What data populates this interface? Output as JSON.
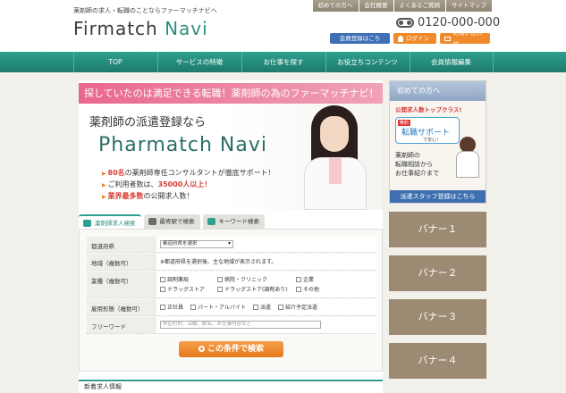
{
  "header": {
    "tagline": "薬剤師の求人・転職のことならファーマッチナビへ",
    "logo_main": "Firmatch ",
    "logo_accent": "Navi",
    "top_links": [
      "初めての方へ",
      "会社概要",
      "よくあるご質問",
      "サイトマップ"
    ],
    "tel": "0120-000-000",
    "buttons": {
      "register": "会員登録はこちら！",
      "login": "ログイン",
      "contact": "お問い合わせ"
    }
  },
  "nav": [
    "TOP",
    "サービスの特徴",
    "お仕事を探す",
    "お役立ちコンテンツ",
    "会員情報編集"
  ],
  "hero": {
    "headline": "探していたのは満足できる転職！薬剤師の為のファーマッチナビ！",
    "sub": "薬剤師の派遣登録なら",
    "brand": "Pharmatch Navi",
    "points": [
      {
        "hl": "80名",
        "text": "の薬剤師専任コンサルタントが徹底サポート！"
      },
      {
        "pre": "ご利用者数は、",
        "hl": "35000人以上！",
        "text": ""
      },
      {
        "hl": "業界最多数",
        "text": "の公開求人数！"
      }
    ]
  },
  "tabs": [
    "薬剤師求人検索",
    "最寄駅で検索",
    "キーワード検索"
  ],
  "search": {
    "pref_label": "都道府県",
    "pref_select": "都道府県を選択",
    "area_label": "地域（複数可）",
    "area_note": "※都道府県を選択後、主な地域が表示されます。",
    "type_label": "業種（複数可）",
    "types": [
      "調剤薬局",
      "病院・クリニック",
      "企業",
      "ドラッグストア",
      "ドラッグストア(調剤あり)",
      "その他"
    ],
    "employ_label": "雇用形態（複数可）",
    "employs": [
      "正社員",
      "パート・アルバイト",
      "派遣",
      "紹介予定派遣"
    ],
    "free_label": "フリーワード",
    "free_placeholder": "市区町村、沿線、駅名、お仕事内容など",
    "submit": "この条件で検索"
  },
  "news_title": "新着求人情報",
  "side": {
    "first_title": "初めての方へ",
    "red": "公開求人数トップクラス!",
    "tag": "無料",
    "bubble_title": "転職サポート",
    "bubble_sub": "で安心！",
    "desc": [
      "薬剤師の",
      "転職相談から",
      "お仕事紹介まで"
    ],
    "bottom": "派遣スタッフ登録はこちら",
    "banners": [
      "バナー１",
      "バナー２",
      "バナー３",
      "バナー４"
    ]
  },
  "colors": {
    "teal": "#2ea08e",
    "orange": "#ef8b2a",
    "blue": "#3f6fb6",
    "pink": "#e9678e",
    "banner": "#9c8a72"
  }
}
